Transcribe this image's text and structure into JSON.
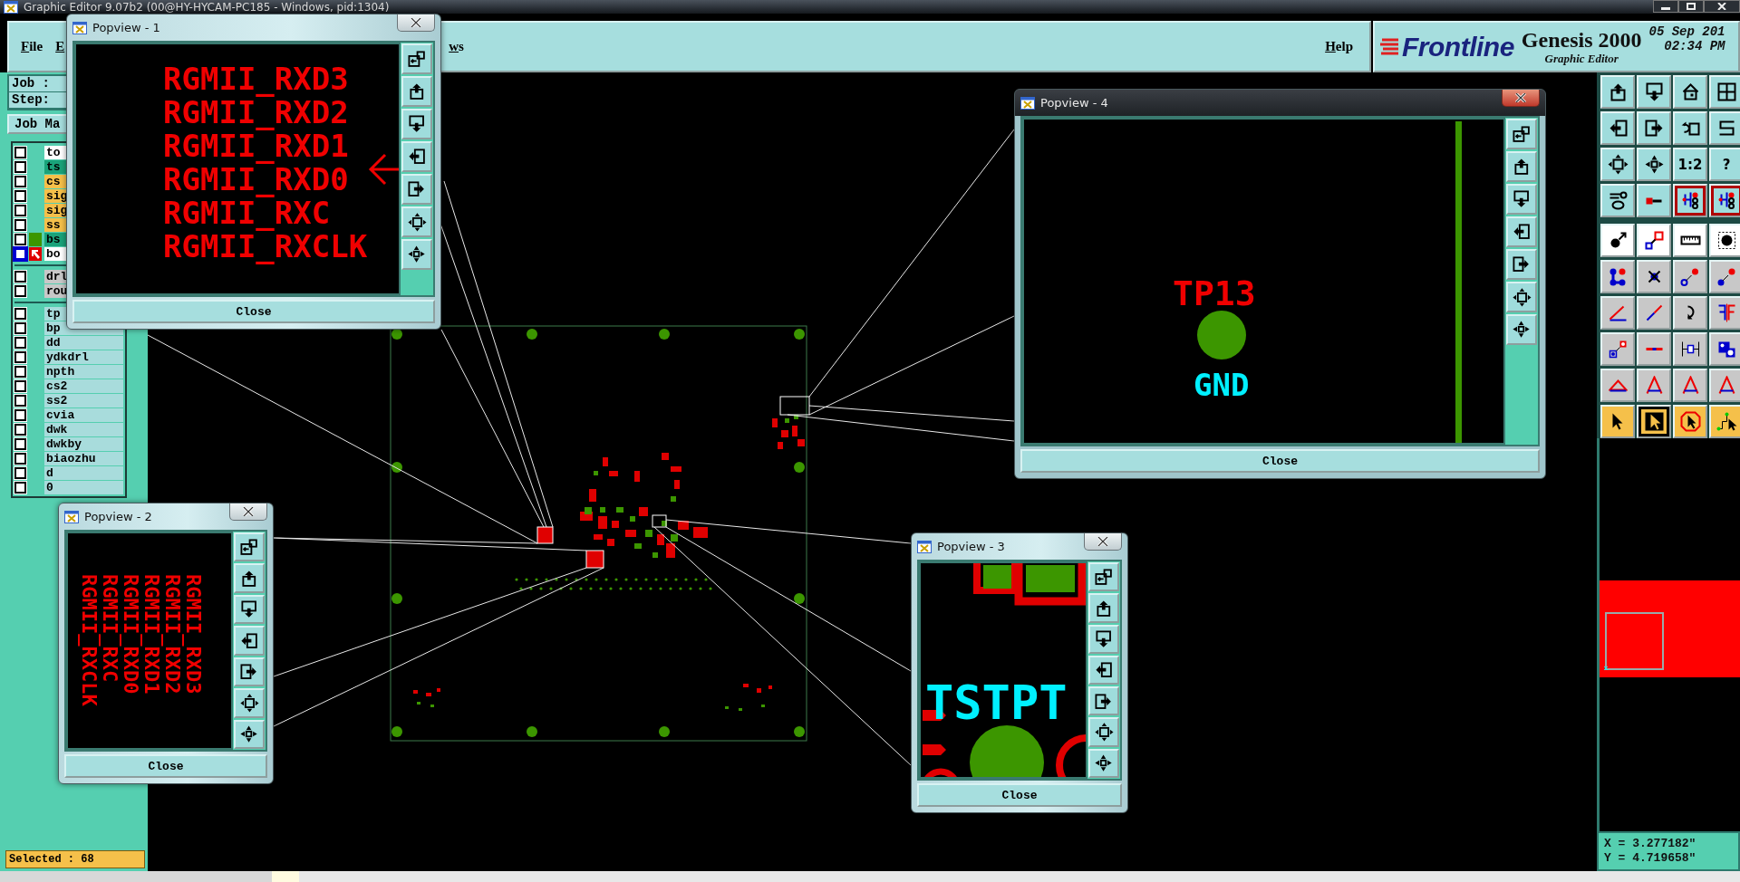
{
  "window": {
    "title": "Graphic Editor 9.07b2 (00@HY-HYCAM-PC185 - Windows, pid:1304)"
  },
  "menu": [
    "File",
    "E",
    "ws",
    "Help"
  ],
  "brand": {
    "logo": "Frontline",
    "product": "Genesis 2000",
    "subtitle": "Graphic Editor",
    "date": "05 Sep 201",
    "time": "02:34 PM"
  },
  "job": {
    "job_label": "Job :",
    "step_label": "Step:",
    "job_manager": "Job Ma"
  },
  "layer_groups": [
    [
      {
        "name": "to",
        "checked": false,
        "active": false,
        "color": "#ffffff"
      },
      {
        "name": "ts",
        "checked": false,
        "active": false,
        "color": "#1aa37a"
      },
      {
        "name": "cs",
        "checked": false,
        "active": false,
        "color": "#f5c04a"
      },
      {
        "name": "sig",
        "checked": false,
        "active": false,
        "color": "#f5c04a"
      },
      {
        "name": "sig",
        "checked": false,
        "active": false,
        "color": "#f5c04a"
      },
      {
        "name": "ss",
        "checked": false,
        "active": false,
        "color": "#f5c04a"
      },
      {
        "name": "bs",
        "checked": false,
        "active": false,
        "color": "#1aa37a",
        "swatch": {
          "color": "#3c9600"
        }
      },
      {
        "name": "bo",
        "checked": false,
        "active": true,
        "color": "#ffffff"
      }
    ],
    [
      {
        "name": "drl",
        "checked": false,
        "active": false,
        "color": "#c8c8c8"
      },
      {
        "name": "rou",
        "checked": false,
        "active": false,
        "color": "#c8c8c8"
      }
    ],
    [
      {
        "name": "tp",
        "checked": false,
        "active": false,
        "color": "#a8dcdc"
      },
      {
        "name": "bp",
        "checked": false,
        "active": false,
        "color": "#a8dcdc"
      },
      {
        "name": "dd",
        "checked": false,
        "active": false,
        "color": "#a8dcdc"
      },
      {
        "name": "ydkdrl",
        "checked": false,
        "active": false,
        "color": "#a8dcdc"
      },
      {
        "name": "npth",
        "checked": false,
        "active": false,
        "color": "#a8dcdc"
      },
      {
        "name": "cs2",
        "checked": false,
        "active": false,
        "color": "#a8dcdc"
      },
      {
        "name": "ss2",
        "checked": false,
        "active": false,
        "color": "#a8dcdc"
      },
      {
        "name": "cvia",
        "checked": false,
        "active": false,
        "color": "#a8dcdc"
      },
      {
        "name": "dwk",
        "checked": false,
        "active": false,
        "color": "#a8dcdc"
      },
      {
        "name": "dwkby",
        "checked": false,
        "active": false,
        "color": "#a8dcdc"
      },
      {
        "name": "biaozhu",
        "checked": false,
        "active": false,
        "color": "#a8dcdc"
      },
      {
        "name": "d",
        "checked": false,
        "active": false,
        "color": "#a8dcdc"
      },
      {
        "name": "0",
        "checked": false,
        "active": false,
        "color": "#a8dcdc"
      }
    ]
  ],
  "status": {
    "selected": "Selected : 68"
  },
  "toolbar": [
    {
      "kind": "view",
      "on": false
    },
    {
      "kind": "view",
      "on": false
    },
    {
      "kind": "view",
      "on": false
    },
    {
      "kind": "view",
      "on": false
    },
    {
      "kind": "view",
      "on": false
    },
    {
      "kind": "view",
      "on": false
    },
    {
      "kind": "view",
      "on": false
    },
    {
      "kind": "view",
      "on": false
    },
    {
      "kind": "view",
      "on": false
    },
    {
      "kind": "view",
      "on": false
    },
    {
      "kind": "view",
      "on": false,
      "label": "1:2"
    },
    {
      "kind": "view",
      "on": false,
      "label": "?"
    },
    {
      "kind": "view",
      "on": false
    },
    {
      "kind": "view",
      "on": false
    },
    {
      "kind": "view",
      "on": true
    },
    {
      "kind": "view",
      "on": true
    },
    {
      "kind": "snap",
      "on": false
    },
    {
      "kind": "snap",
      "on": false
    },
    {
      "kind": "snap",
      "on": false
    },
    {
      "kind": "snap",
      "on": false
    },
    {
      "kind": "edit",
      "on": false
    },
    {
      "kind": "edit",
      "on": false
    },
    {
      "kind": "edit",
      "on": false
    },
    {
      "kind": "edit",
      "on": false
    },
    {
      "kind": "edit",
      "on": false
    },
    {
      "kind": "edit",
      "on": false
    },
    {
      "kind": "edit",
      "on": false
    },
    {
      "kind": "edit",
      "on": false
    },
    {
      "kind": "edit",
      "on": false
    },
    {
      "kind": "edit",
      "on": false
    },
    {
      "kind": "edit",
      "on": false
    },
    {
      "kind": "edit",
      "on": false
    },
    {
      "kind": "edit",
      "on": false
    },
    {
      "kind": "edit",
      "on": false
    },
    {
      "kind": "edit",
      "on": false
    },
    {
      "kind": "edit",
      "on": false
    },
    {
      "kind": "select",
      "on": false
    },
    {
      "kind": "select",
      "on": true
    },
    {
      "kind": "select",
      "on": false
    },
    {
      "kind": "select",
      "on": false
    }
  ],
  "coordinates": {
    "x": "X = 3.277182\"",
    "y": "Y = 4.719658\""
  },
  "popviews": [
    {
      "title": "Popview - 1",
      "active": false,
      "close_label": "Close",
      "content": {
        "kind": "net_labels",
        "lines": [
          "RGMII_RXD3",
          "RGMII_RXD2",
          "RGMII_RXD1",
          "RGMII_RXD0",
          "RGMII_RXC",
          "RGMII_RXCLK"
        ]
      }
    },
    {
      "title": "Popview - 2",
      "active": false,
      "close_label": "Close",
      "content": {
        "kind": "net_labels_rotated",
        "lines": [
          "RGMII_RXD3",
          "RGMII_RXD2",
          "RGMII_RXD1",
          "RGMII_RXD0",
          "RGMII_RXC",
          "RGMII_RXCLK"
        ]
      }
    },
    {
      "title": "Popview - 3",
      "active": false,
      "close_label": "Close",
      "content": {
        "kind": "pad_label",
        "label": "TSTPT"
      }
    },
    {
      "title": "Popview - 4",
      "active": true,
      "close_label": "Close",
      "content": {
        "kind": "test_point",
        "ref": "TP13",
        "net": "GND"
      }
    }
  ]
}
